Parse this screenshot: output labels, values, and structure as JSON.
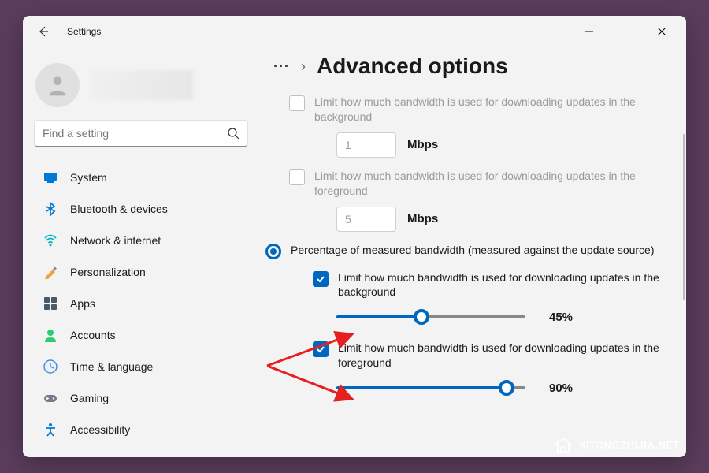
{
  "window": {
    "title": "Settings"
  },
  "search": {
    "placeholder": "Find a setting"
  },
  "nav": [
    {
      "icon": "system",
      "iconColor": "#0078d4",
      "label": "System"
    },
    {
      "icon": "bluetooth",
      "iconColor": "#0078d4",
      "label": "Bluetooth & devices"
    },
    {
      "icon": "network",
      "iconColor": "#00b7c3",
      "label": "Network & internet"
    },
    {
      "icon": "personalization",
      "iconColor": "#e8a33d",
      "label": "Personalization"
    },
    {
      "icon": "apps",
      "iconColor": "#4a5a6a",
      "label": "Apps"
    },
    {
      "icon": "accounts",
      "iconColor": "#2ecc71",
      "label": "Accounts"
    },
    {
      "icon": "time",
      "iconColor": "#4a90d9",
      "label": "Time & language"
    },
    {
      "icon": "gaming",
      "iconColor": "#7a7a8a",
      "label": "Gaming"
    },
    {
      "icon": "accessibility",
      "iconColor": "#0078d4",
      "label": "Accessibility"
    }
  ],
  "breadcrumb": {
    "page_title": "Advanced options"
  },
  "options": {
    "absolute_bg": {
      "label": "Limit how much bandwidth is used for downloading updates in the background",
      "value": "1",
      "unit": "Mbps",
      "checked": false,
      "disabled": true
    },
    "absolute_fg": {
      "label": "Limit how much bandwidth is used for downloading updates in the foreground",
      "value": "5",
      "unit": "Mbps",
      "checked": false,
      "disabled": true
    },
    "percentage_radio": {
      "label": "Percentage of measured bandwidth (measured against the update source)",
      "selected": true
    },
    "percent_bg": {
      "label": "Limit how much bandwidth is used for downloading updates in the background",
      "checked": true,
      "percent": 45,
      "percent_text": "45%"
    },
    "percent_fg": {
      "label": "Limit how much bandwidth is used for downloading updates in the foreground",
      "checked": true,
      "percent": 90,
      "percent_text": "90%"
    }
  },
  "watermark": {
    "text": "XITONGZHIJIA.NET"
  },
  "colors": {
    "accent": "#0067c0"
  }
}
